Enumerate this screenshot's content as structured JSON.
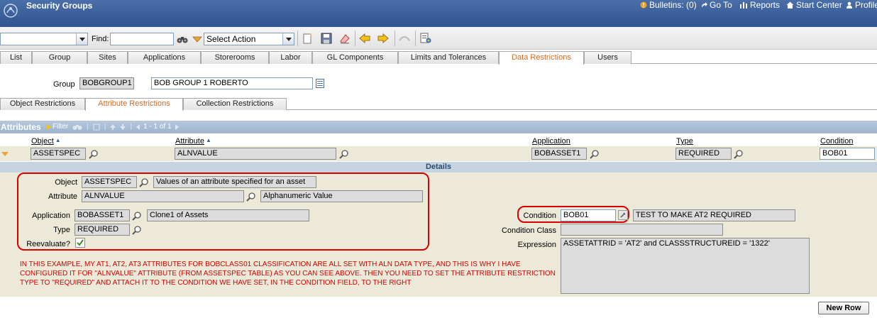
{
  "app": {
    "title": "Security Groups"
  },
  "nav": {
    "bulletins": "Bulletins: (0)",
    "goto": "Go To",
    "reports": "Reports",
    "start_center": "Start Center",
    "profile": "Profile"
  },
  "toolbar": {
    "find_label": "Find:",
    "find_value": "",
    "search_value": "",
    "action_select": "Select Action"
  },
  "main_tabs": [
    "List",
    "Group",
    "Sites",
    "Applications",
    "Storerooms",
    "Labor",
    "GL Components",
    "Limits and Tolerances",
    "Data Restrictions",
    "Users"
  ],
  "active_main_tab": "Data Restrictions",
  "group": {
    "label": "Group",
    "code": "BOBGROUP1",
    "description": "BOB GROUP 1 ROBERTO"
  },
  "sub_tabs": [
    "Object Restrictions",
    "Attribute Restrictions",
    "Collection Restrictions"
  ],
  "active_sub_tab": "Attribute Restrictions",
  "attributes_bar": {
    "title": "Attributes",
    "filter": "Filter",
    "paging": "1 - 1 of 1"
  },
  "columns": {
    "object": "Object",
    "attribute": "Attribute",
    "application": "Application",
    "type": "Type",
    "condition": "Condition"
  },
  "row": {
    "object": "ASSETSPEC",
    "attribute": "ALNVALUE",
    "application": "BOBASSET1",
    "type": "REQUIRED",
    "condition": "BOB01"
  },
  "details": {
    "title": "Details",
    "object_label": "Object",
    "object_value": "ASSETSPEC",
    "object_desc": "Values of an attribute specified for an asset",
    "attribute_label": "Attribute",
    "attribute_value": "ALNVALUE",
    "attribute_desc": "Alphanumeric Value",
    "application_label": "Application",
    "application_value": "BOBASSET1",
    "application_desc": "Clone1 of Assets",
    "type_label": "Type",
    "type_value": "REQUIRED",
    "reevaluate_label": "Reevaluate?",
    "condition_label": "Condition",
    "condition_value": "BOB01",
    "condition_desc": "TEST TO MAKE AT2 REQUIRED",
    "condition_class_label": "Condition Class",
    "condition_class_value": "",
    "expression_label": "Expression",
    "expression_value": "ASSETATTRID = 'AT2' and CLASSSTRUCTUREID = '1322'"
  },
  "note": "IN THIS EXAMPLE, MY AT1, AT2, AT3 ATTRIBUTES FOR BOBCLASS01 CLASSIFICATION ARE ALL SET WITH ALN DATA TYPE, AND THIS IS WHY I HAVE CONFIGURED IT FOR \"ALNVALUE\" ATTRIBUTE (FROM ASSETSPEC TABLE) AS YOU CAN SEE ABOVE.  THEN YOU NEED TO SET THE ATTRIBUTE RESTRICTION TYPE TO \"REQUIRED\" AND ATTACH IT TO THE CONDITION WE HAVE SET, IN THE CONDITION FIELD, TO THE RIGHT",
  "buttons": {
    "new_row": "New Row"
  },
  "colors": {
    "accent": "#d46a1e",
    "titlebar": "#3a5f9c",
    "annotation": "#d90000"
  }
}
